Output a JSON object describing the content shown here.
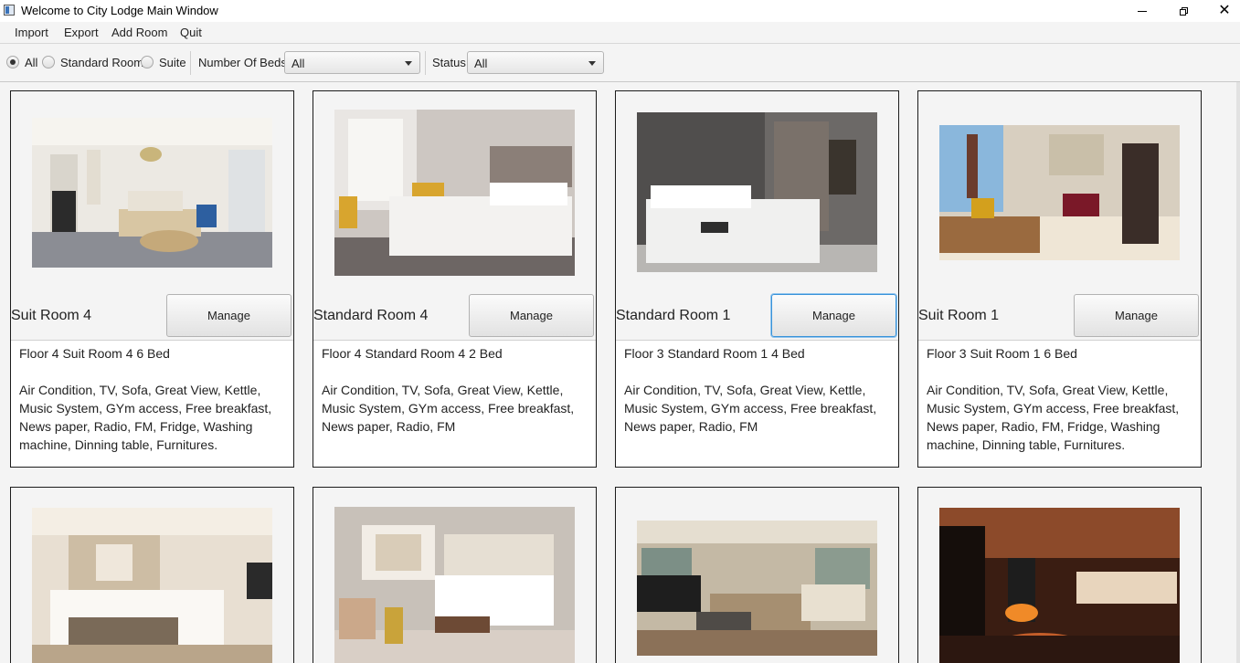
{
  "window": {
    "title": "Welcome to City Lodge Main Window"
  },
  "menu": [
    "Import",
    "Export",
    "Add Room",
    "Quit"
  ],
  "filters": {
    "room_types": [
      {
        "label": "All",
        "checked": true
      },
      {
        "label": "Standard Room",
        "checked": false
      },
      {
        "label": "Suite",
        "checked": false
      }
    ],
    "beds_label": "Number Of Beds",
    "beds_value": "All",
    "status_label": "Status",
    "status_value": "All"
  },
  "rooms": [
    {
      "name": "Suit Room 4",
      "button": "Manage",
      "location": "Floor 4 Suit Room 4 6 Bed",
      "features": "Air Condition, TV, Sofa, Great View, Kettle, Music System, GYm access, Free breakfast, News paper, Radio, FM, Fridge, Washing machine, Dinning table, Furnitures.",
      "focused": false
    },
    {
      "name": "Standard Room 4",
      "button": "Manage",
      "location": "Floor 4 Standard Room 4 2 Bed",
      "features": "Air Condition, TV, Sofa, Great View, Kettle, Music System, GYm access, Free breakfast, News paper, Radio, FM",
      "focused": false
    },
    {
      "name": "Standard Room 1",
      "button": "Manage",
      "location": "Floor 3 Standard Room 1 4 Bed",
      "features": "Air Condition, TV, Sofa, Great View, Kettle, Music System, GYm access, Free breakfast, News paper, Radio, FM",
      "focused": true
    },
    {
      "name": "Suit Room 1",
      "button": "Manage",
      "location": "Floor 3 Suit Room 1 6 Bed",
      "features": "Air Condition, TV, Sofa, Great View, Kettle, Music System, GYm access, Free breakfast, News paper, Radio, FM, Fridge, Washing machine, Dinning table, Furnitures.",
      "focused": false
    }
  ],
  "colors": {
    "focus_ring": "#3a93d9",
    "card_border": "#1c1c1c"
  }
}
